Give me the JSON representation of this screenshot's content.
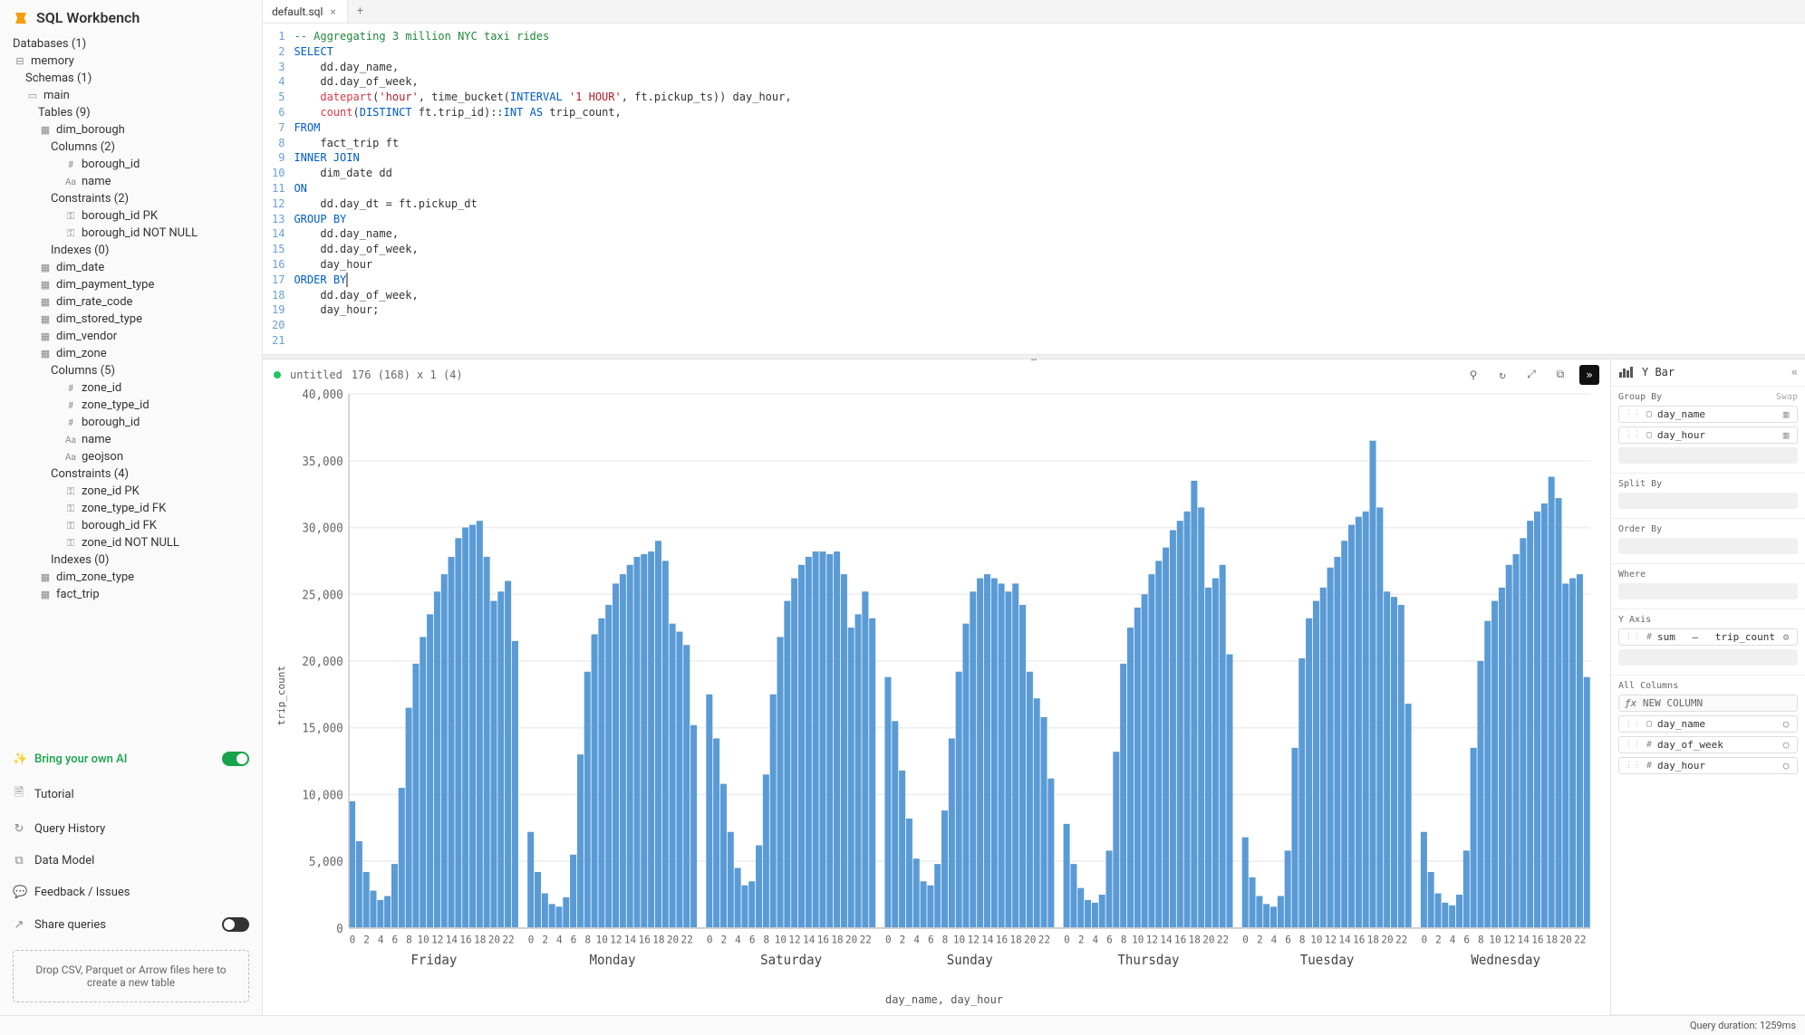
{
  "app": {
    "title": "SQL Workbench"
  },
  "sidebar": {
    "databases_label": "Databases (1)",
    "db": "memory",
    "schemas_label": "Schemas (1)",
    "schema": "main",
    "tables_label": "Tables (9)",
    "dim_borough": {
      "name": "dim_borough",
      "columns_label": "Columns (2)",
      "cols": [
        "borough_id",
        "name"
      ],
      "col_types": [
        "#",
        "Aa"
      ],
      "constraints_label": "Constraints (2)",
      "constraints": [
        "borough_id PK",
        "borough_id NOT NULL"
      ],
      "indexes_label": "Indexes (0)"
    },
    "simple_tables": [
      "dim_date",
      "dim_payment_type",
      "dim_rate_code",
      "dim_stored_type",
      "dim_vendor"
    ],
    "dim_zone": {
      "name": "dim_zone",
      "columns_label": "Columns (5)",
      "cols": [
        "zone_id",
        "zone_type_id",
        "borough_id",
        "name",
        "geojson"
      ],
      "col_types": [
        "#",
        "#",
        "#",
        "Aa",
        "Aa"
      ],
      "constraints_label": "Constraints (4)",
      "constraints": [
        "zone_id PK",
        "zone_type_id FK",
        "borough_id FK",
        "zone_id NOT NULL"
      ],
      "indexes_label": "Indexes (0)"
    },
    "tail_tables": [
      "dim_zone_type",
      "fact_trip"
    ],
    "links": {
      "ai": "Bring your own AI",
      "tutorial": "Tutorial",
      "history": "Query History",
      "model": "Data Model",
      "feedback": "Feedback / Issues",
      "share": "Share queries"
    },
    "drop": "Drop CSV, Parquet or Arrow files here to create a new table"
  },
  "tabs": {
    "active": "default.sql"
  },
  "editor_lines": 21,
  "result_meta": {
    "title": "untitled",
    "shape": "176 (168) x 1 (4)"
  },
  "chart_panel": {
    "title": "Y Bar",
    "group_by_label": "Group By",
    "swap": "Swap",
    "group_by": [
      "day_name",
      "day_hour"
    ],
    "group_by_types": [
      "▢",
      "▢"
    ],
    "split_label": "Split By",
    "order_label": "Order By",
    "where_label": "Where",
    "yaxis_label": "Y Axis",
    "yaxis_agg": "sum",
    "yaxis_sep": "—",
    "yaxis_field": "trip_count",
    "all_cols_label": "All Columns",
    "newcol": "NEW COLUMN",
    "all_cols": [
      "day_name",
      "day_of_week",
      "day_hour"
    ],
    "all_col_types": [
      "▢",
      "#",
      "#"
    ]
  },
  "xlabel": "day_name, day_hour",
  "ylabel": "trip_count",
  "status": {
    "duration": "Query duration: 1259ms"
  },
  "chart_data": {
    "type": "bar",
    "ylabel": "trip_count",
    "xlabel": "day_name, day_hour",
    "ylim": [
      0,
      40000
    ],
    "yticks": [
      0,
      5000,
      10000,
      15000,
      20000,
      25000,
      30000,
      35000,
      40000
    ],
    "ytick_labels": [
      "0",
      "5,000",
      "10,000",
      "15,000",
      "20,000",
      "25,000",
      "30,000",
      "35,000",
      "40,000"
    ],
    "x_major": [
      "Friday",
      "Monday",
      "Saturday",
      "Sunday",
      "Thursday",
      "Tuesday",
      "Wednesday"
    ],
    "x_minor": [
      0,
      2,
      4,
      6,
      8,
      10,
      12,
      14,
      16,
      18,
      20,
      22
    ],
    "series": [
      {
        "name": "Friday",
        "values": [
          9500,
          6500,
          4200,
          2800,
          2100,
          2400,
          4800,
          10500,
          16500,
          19800,
          21800,
          23500,
          25200,
          26500,
          27800,
          29200,
          30000,
          30200,
          30500,
          27800,
          24500,
          25200,
          26000,
          21500
        ]
      },
      {
        "name": "Monday",
        "values": [
          7200,
          4200,
          2600,
          1800,
          1600,
          2300,
          5500,
          13000,
          19200,
          22000,
          23200,
          24200,
          25800,
          26500,
          27200,
          27800,
          28000,
          28200,
          29000,
          27500,
          22800,
          22200,
          21200,
          15200
        ]
      },
      {
        "name": "Saturday",
        "values": [
          17500,
          14200,
          10800,
          7200,
          4500,
          3200,
          3500,
          6200,
          11500,
          17500,
          21800,
          24500,
          26200,
          27200,
          27800,
          28200,
          28200,
          28000,
          28200,
          26500,
          22500,
          23500,
          25200,
          23200
        ]
      },
      {
        "name": "Sunday",
        "values": [
          18800,
          15500,
          11800,
          8200,
          5200,
          3500,
          3200,
          4800,
          8800,
          14200,
          19200,
          22800,
          25200,
          26200,
          26500,
          26200,
          25800,
          25200,
          25800,
          24200,
          19200,
          17200,
          15800,
          11200
        ]
      },
      {
        "name": "Thursday",
        "values": [
          7800,
          4800,
          3000,
          2100,
          1900,
          2500,
          5800,
          13200,
          19800,
          22500,
          24000,
          25000,
          26500,
          27500,
          28500,
          29800,
          30500,
          31200,
          33500,
          31500,
          25500,
          26200,
          27200,
          20500
        ]
      },
      {
        "name": "Tuesday",
        "values": [
          6800,
          3800,
          2400,
          1800,
          1600,
          2400,
          5800,
          13500,
          20200,
          23200,
          24500,
          25500,
          27000,
          27800,
          29000,
          30200,
          30800,
          31200,
          36500,
          31500,
          25200,
          24800,
          24200,
          16800
        ]
      },
      {
        "name": "Wednesday",
        "values": [
          7200,
          4200,
          2600,
          1900,
          1700,
          2500,
          5800,
          13500,
          20000,
          23000,
          24500,
          25500,
          27200,
          28000,
          29200,
          30500,
          31200,
          31800,
          33800,
          32200,
          25800,
          26200,
          26500,
          18800
        ]
      }
    ]
  }
}
